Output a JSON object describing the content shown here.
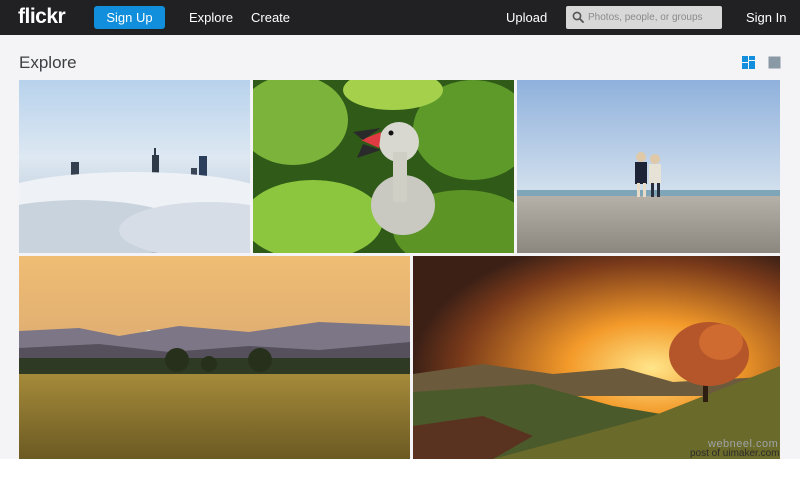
{
  "header": {
    "logo": "flickr",
    "signup_label": "Sign Up",
    "explore_label": "Explore",
    "create_label": "Create",
    "upload_label": "Upload",
    "search_placeholder": "Photos, people, or groups",
    "signin_label": "Sign In"
  },
  "main": {
    "title": "Explore",
    "view_icons": [
      "justified-view-icon",
      "single-view-icon"
    ],
    "active_view": "justified"
  },
  "colors": {
    "topbar": "#212124",
    "signup": "#128fdc",
    "page_bg": "#f4f4f6"
  },
  "watermarks": {
    "line1": "webneel.com",
    "line2": "post of uimaker.com"
  }
}
